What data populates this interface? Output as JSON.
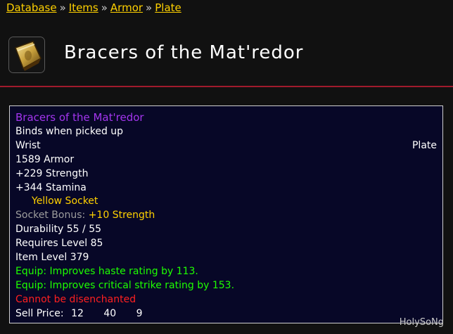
{
  "breadcrumb": {
    "items": [
      "Database",
      "Items",
      "Armor",
      "Plate"
    ],
    "separator": "»"
  },
  "header": {
    "title": "Bracers of the Mat'redor",
    "icon": "bracers-icon"
  },
  "tooltip": {
    "name": "Bracers of the Mat'redor",
    "binding": "Binds when picked up",
    "slot": "Wrist",
    "armor_type": "Plate",
    "armor": "1589 Armor",
    "strength": "+229 Strength",
    "stamina": "+344 Stamina",
    "socket": "Yellow Socket",
    "socket_bonus_label": "Socket Bonus:",
    "socket_bonus_value": "+10 Strength",
    "durability": "Durability 55 / 55",
    "requires_level": "Requires Level 85",
    "item_level": "Item Level 379",
    "equip_haste": "Equip: Improves haste rating by 113.",
    "equip_crit": "Equip: Improves critical strike rating by 153.",
    "disenchant": "Cannot be disenchanted",
    "sell_price_label": "Sell Price:",
    "sell_gold": "12",
    "sell_silver": "40",
    "sell_copper": "9"
  },
  "colors": {
    "quality_epic": "#a335ee",
    "socket_yellow": "#ffd100",
    "equip_green": "#1eff00",
    "warning_red": "#ff2020",
    "header_rule": "#a11a2c",
    "link": "#ffd100"
  },
  "watermark": "HolySoNg"
}
